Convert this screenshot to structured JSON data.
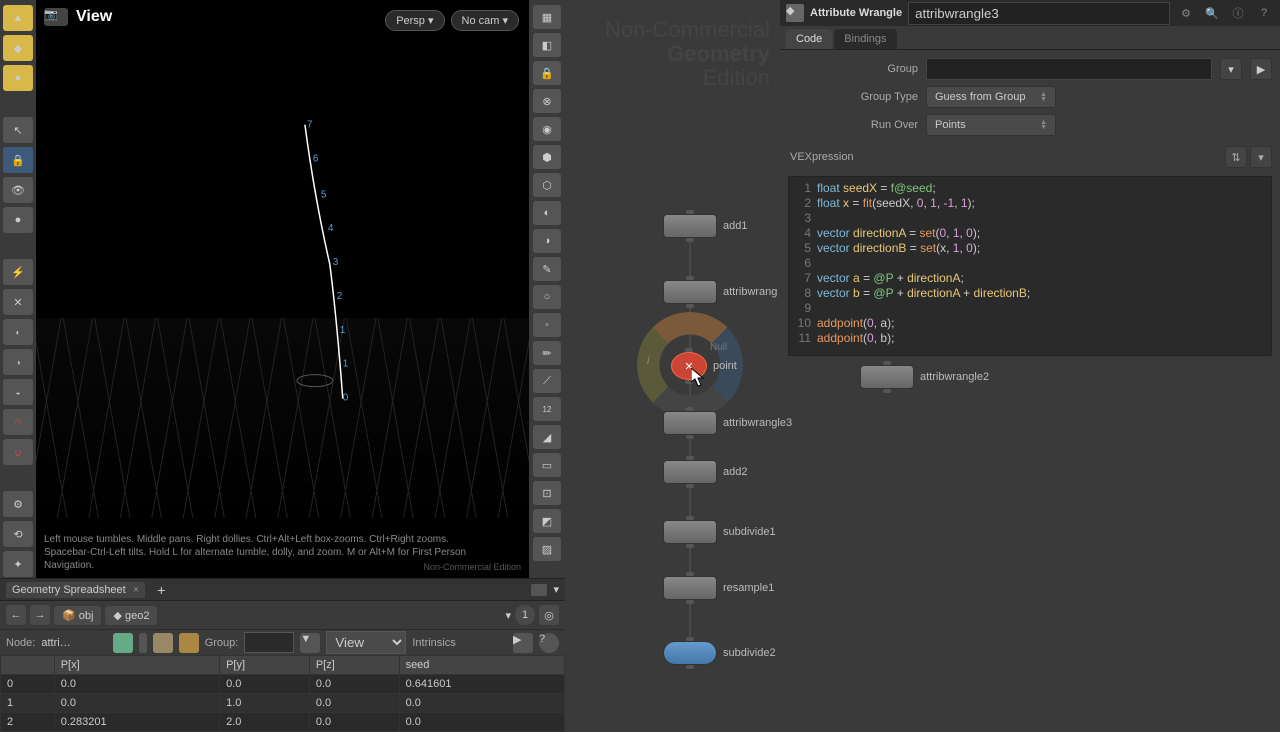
{
  "viewport": {
    "title": "View",
    "persp": "Persp",
    "cam": "No cam",
    "hint": "Left mouse tumbles. Middle pans. Right dollies. Ctrl+Alt+Left box-zooms. Ctrl+Right zooms. Spacebar-Ctrl-Left tilts. Hold L for alternate tumble, dolly, and zoom. M or Alt+M for First Person Navigation.",
    "watermark_line1": "Non-Commercial",
    "watermark_line2": "Edition",
    "bottom_watermark": "Non-Commercial Edition",
    "curve_points": [
      "7",
      "6",
      "5",
      "4",
      "3",
      "2",
      "1",
      "0"
    ]
  },
  "spreadsheet": {
    "tab": "Geometry Spreadsheet",
    "path_obj": "obj",
    "path_geo": "geo2",
    "node_label": "Node:",
    "node_value": "attri…",
    "group_label": "Group:",
    "view_label": "View",
    "intrinsics": "Intrinsics",
    "columns": [
      "",
      "P[x]",
      "P[y]",
      "P[z]",
      "seed"
    ],
    "rows": [
      [
        "0",
        "0.0",
        "0.0",
        "0.0",
        "0.641601"
      ],
      [
        "1",
        "0.0",
        "1.0",
        "0.0",
        "0.0"
      ],
      [
        "2",
        "0.283201",
        "2.0",
        "0.0",
        "0.0"
      ]
    ]
  },
  "nodes": {
    "add1": "add1",
    "attribwrang": "attribwrang",
    "point": "point",
    "null_label": "Null",
    "attribwrangle3": "attribwrangle3",
    "add2": "add2",
    "subdivide1": "subdivide1",
    "resample1": "resample1",
    "subdivide2": "subdivide2",
    "attribwrangle2": "attribwrangle2",
    "info_i": "i"
  },
  "attr": {
    "header_title": "Attribute Wrangle",
    "header_name": "attribwrangle3",
    "tab_code": "Code",
    "tab_bindings": "Bindings",
    "group_label": "Group",
    "group_type_label": "Group Type",
    "group_type_value": "Guess from Group",
    "run_over_label": "Run Over",
    "run_over_value": "Points",
    "vex_label": "VEXpression",
    "code": [
      {
        "n": "1",
        "html": "<span class='kw-type'>float</span> <span class='kw-var'>seedX</span> <span class='kw-op'>=</span> <span class='kw-attr'>f@seed</span><span class='kw-op'>;</span>"
      },
      {
        "n": "2",
        "html": "<span class='kw-type'>float</span> <span class='kw-var'>x</span> <span class='kw-op'>=</span> <span class='kw-func'>fit</span><span class='kw-op'>(seedX, </span><span class='kw-num'>0</span><span class='kw-op'>, </span><span class='kw-num'>1</span><span class='kw-op'>, </span><span class='kw-num'>-1</span><span class='kw-op'>, </span><span class='kw-num'>1</span><span class='kw-op'>);</span>"
      },
      {
        "n": "3",
        "html": ""
      },
      {
        "n": "4",
        "html": "<span class='kw-type'>vector</span> <span class='kw-var'>directionA</span> <span class='kw-op'>=</span> <span class='kw-func'>set</span><span class='kw-op'>(</span><span class='kw-num'>0</span><span class='kw-op'>, </span><span class='kw-num'>1</span><span class='kw-op'>, </span><span class='kw-num'>0</span><span class='kw-op'>);</span>"
      },
      {
        "n": "5",
        "html": "<span class='kw-type'>vector</span> <span class='kw-var'>directionB</span> <span class='kw-op'>=</span> <span class='kw-func'>set</span><span class='kw-op'>(x, </span><span class='kw-num'>1</span><span class='kw-op'>, </span><span class='kw-num'>0</span><span class='kw-op'>);</span>"
      },
      {
        "n": "6",
        "html": ""
      },
      {
        "n": "7",
        "html": "<span class='kw-type'>vector</span> <span class='kw-var'>a</span> <span class='kw-op'>=</span> <span class='kw-attr'>@P</span> <span class='kw-op'>+</span> <span class='kw-var'>directionA</span><span class='kw-op'>;</span>"
      },
      {
        "n": "8",
        "html": "<span class='kw-type'>vector</span> <span class='kw-var'>b</span> <span class='kw-op'>=</span> <span class='kw-attr'>@P</span> <span class='kw-op'>+</span> <span class='kw-var'>directionA</span> <span class='kw-op'>+</span> <span class='kw-var'>directionB</span><span class='kw-op'>;</span>"
      },
      {
        "n": "9",
        "html": ""
      },
      {
        "n": "10",
        "html": "<span class='kw-func'>addpoint</span><span class='kw-op'>(</span><span class='kw-num'>0</span><span class='kw-op'>, a);</span>"
      },
      {
        "n": "11",
        "html": "<span class='kw-func'>addpoint</span><span class='kw-op'>(</span><span class='kw-num'>0</span><span class='kw-op'>, b);</span>"
      }
    ]
  }
}
